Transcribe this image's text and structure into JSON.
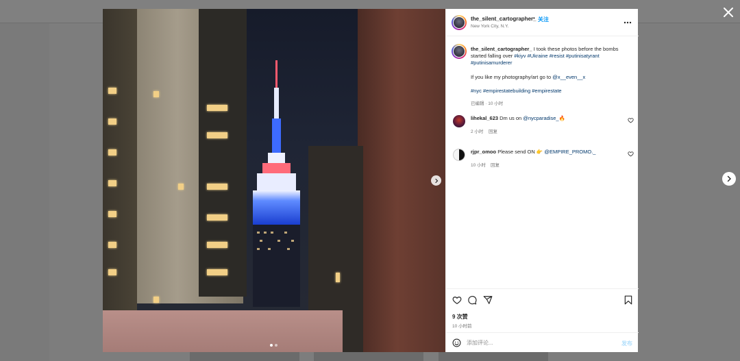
{
  "post": {
    "username": "the_silent_cartographer_",
    "separator": "•",
    "follow_label": "关注",
    "location": "New York City, N.Y."
  },
  "caption": {
    "username": "the_silent_cartographer_",
    "text_1": "I took these photos before the bombs started falling over",
    "tags_1": [
      "#kiyv",
      "#Ukraine",
      "#resist",
      "#putinisatyrant",
      "#putinisamurderer"
    ],
    "text_2": "If you like my photography/art go to",
    "mention": "@x__even__x",
    "tags_2": [
      "#nyc",
      "#empirestatebuilding",
      "#empirestate"
    ],
    "meta": "已编辑 · 10 小时"
  },
  "comments": [
    {
      "username": "lihekal_623",
      "text": "Dm us on",
      "mention": "@nycparadise_",
      "emoji": "🔥",
      "time": "2 小时",
      "reply_label": "回复"
    },
    {
      "username": "rjpr_omoo",
      "text": "Please send ON",
      "emoji": "👉",
      "mention": "@EMPIRE_PROMO._",
      "time": "10 小时",
      "reply_label": "回复"
    }
  ],
  "stats": {
    "likes": "9 次赞",
    "time_ago": "10 小时前"
  },
  "composer": {
    "placeholder": "添加评论...",
    "post_label": "发布"
  },
  "icons": {
    "close": "close-icon",
    "more": "more-options-icon",
    "like": "heart-icon",
    "comment": "comment-icon",
    "share": "share-icon",
    "save": "bookmark-icon",
    "emoji": "emoji-icon",
    "next": "chevron-right-icon"
  },
  "colors": {
    "link_blue": "#0095f6",
    "tag_blue": "#00376b",
    "overlay": "#7d7d7d"
  }
}
